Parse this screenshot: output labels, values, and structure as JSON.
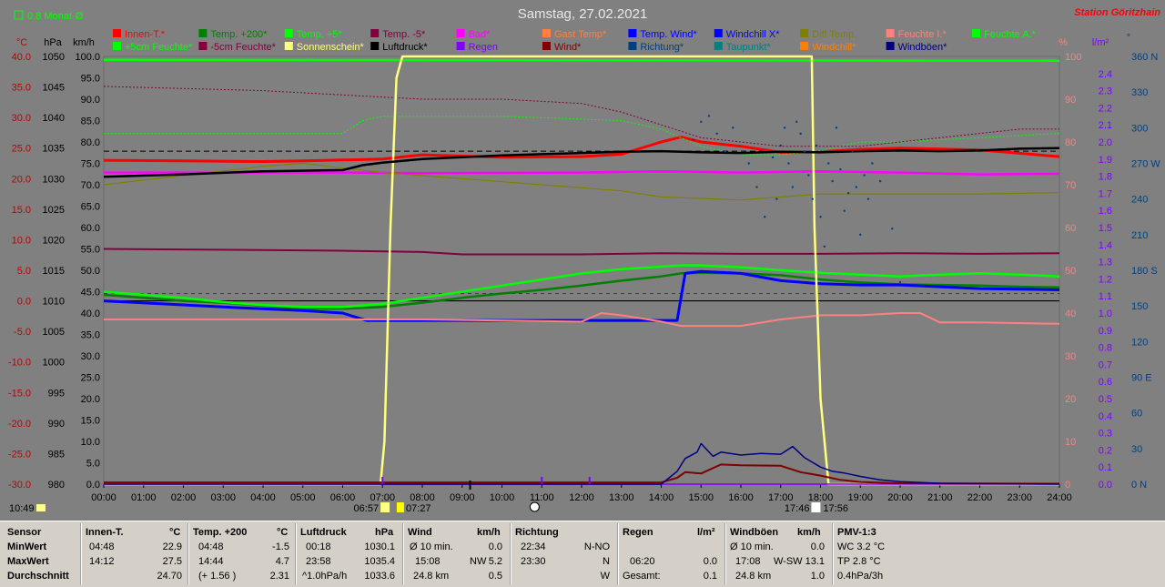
{
  "header": {
    "title": "Samstag, 27.02.2021",
    "station": "Station Göritzhain",
    "monthly_avg": "0.8 Monat-Ø",
    "current_time": "10:49"
  },
  "legend": {
    "row1": [
      {
        "label": "Innen-T.*",
        "color": "#ff0000"
      },
      {
        "label": "Temp. +200*",
        "color": "#008000"
      },
      {
        "label": "Temp. +5*",
        "color": "#00ff00"
      },
      {
        "label": "Temp. -5*",
        "color": "#800040"
      },
      {
        "label": "Bad*",
        "color": "#ff00ff"
      },
      {
        "label": "Gast Temp*",
        "color": "#ff8040"
      },
      {
        "label": "Temp. Wind*",
        "color": "#0000ff"
      },
      {
        "label": "Windchill X*",
        "color": "#0000ff"
      },
      {
        "label": "Diff Temp.",
        "color": "#808000"
      },
      {
        "label": "Feuchte I.*",
        "color": "#ff8080"
      },
      {
        "label": "Feuchte A.*",
        "color": "#00ff00"
      }
    ],
    "row2": [
      {
        "label": "+5cm Feuchte*",
        "color": "#00ff00"
      },
      {
        "label": "-5cm Feuchte*",
        "color": "#800040"
      },
      {
        "label": "Sonnenschein*",
        "color": "#ffff80"
      },
      {
        "label": "Luftdruck*",
        "color": "#000000"
      },
      {
        "label": "Regen",
        "color": "#8000ff"
      },
      {
        "label": "Wind*",
        "color": "#800000"
      },
      {
        "label": "Richtung*",
        "color": "#004080"
      },
      {
        "label": "Taupunkt*",
        "color": "#008080"
      },
      {
        "label": "Windchill*",
        "color": "#ff8000"
      },
      {
        "label": "Windböen*",
        "color": "#000080"
      }
    ]
  },
  "axes": {
    "left_units": {
      "temp": "°C",
      "hpa": "hPa",
      "kmh": "km/h"
    },
    "right_units": {
      "pct": "%",
      "lm2": "l/m²",
      "deg": "°"
    },
    "temp_ticks": [
      "40.0",
      "35.0",
      "30.0",
      "25.0",
      "20.0",
      "15.0",
      "10.0",
      "5.0",
      "0.0",
      "-5.0",
      "-10.0",
      "-15.0",
      "-20.0",
      "-25.0",
      "-30.0"
    ],
    "hpa_ticks": [
      "1050",
      "1045",
      "1040",
      "1035",
      "1030",
      "1025",
      "1020",
      "1015",
      "1010",
      "1005",
      "1000",
      "995",
      "990",
      "985",
      "980"
    ],
    "kmh_ticks": [
      "100.0",
      "95.0",
      "90.0",
      "85.0",
      "80.0",
      "75.0",
      "70.0",
      "65.0",
      "60.0",
      "55.0",
      "50.0",
      "45.0",
      "40.0",
      "35.0",
      "30.0",
      "25.0",
      "20.0",
      "15.0",
      "10.0",
      "5.0",
      "0.0"
    ],
    "pct_ticks": [
      "100",
      "90",
      "80",
      "70",
      "60",
      "50",
      "40",
      "30",
      "20",
      "10",
      "0"
    ],
    "lm2_ticks": [
      "2.4",
      "2.3",
      "2.2",
      "2.1",
      "2.0",
      "1.9",
      "1.8",
      "1.7",
      "1.6",
      "1.5",
      "1.4",
      "1.3",
      "1.2",
      "1.1",
      "1.0",
      "0.9",
      "0.8",
      "0.7",
      "0.6",
      "0.5",
      "0.4",
      "0.3",
      "0.2",
      "0.1",
      "0.0"
    ],
    "deg_ticks": [
      {
        "v": 360,
        "l": "360 N"
      },
      {
        "v": 330,
        "l": "330"
      },
      {
        "v": 300,
        "l": "300"
      },
      {
        "v": 270,
        "l": "270 W"
      },
      {
        "v": 240,
        "l": "240"
      },
      {
        "v": 210,
        "l": "210"
      },
      {
        "v": 180,
        "l": "180 S"
      },
      {
        "v": 150,
        "l": "150"
      },
      {
        "v": 120,
        "l": "120"
      },
      {
        "v": 90,
        "l": "90 E"
      },
      {
        "v": 60,
        "l": "60"
      },
      {
        "v": 30,
        "l": "30"
      },
      {
        "v": 0,
        "l": "0 N"
      }
    ],
    "x_ticks": [
      "00:00",
      "01:00",
      "02:00",
      "03:00",
      "04:00",
      "05:00",
      "06:00",
      "07:00",
      "08:00",
      "09:00",
      "10:00",
      "11:00",
      "12:00",
      "13:00",
      "14:00",
      "15:00",
      "16:00",
      "17:00",
      "18:00",
      "19:00",
      "20:00",
      "21:00",
      "22:00",
      "23:00",
      "24:00"
    ]
  },
  "sun_events": {
    "dawn": "06:57",
    "sunrise": "07:27",
    "sunset": "17:46",
    "dusk": "17:56"
  },
  "chart_data": {
    "type": "line",
    "title": "Samstag, 27.02.2021",
    "x_unit": "hours",
    "xlim": [
      0,
      24
    ],
    "ylim_temp": [
      -30,
      40
    ],
    "ylim_kmh": [
      0,
      100
    ],
    "ylim_pct": [
      0,
      100
    ],
    "series": [
      {
        "name": "Innen-T.*",
        "axis": "temp",
        "color": "#ff0000",
        "x": [
          0,
          2,
          4,
          5,
          7,
          8,
          10,
          12,
          13,
          14,
          14.5,
          15,
          16,
          17,
          18,
          19,
          20,
          22,
          24
        ],
        "y": [
          23.0,
          22.9,
          22.8,
          22.9,
          23.2,
          23.9,
          23.5,
          23.6,
          24.0,
          26.0,
          26.8,
          26.0,
          25.3,
          24.3,
          24.4,
          24.8,
          25.0,
          24.7,
          23.6
        ]
      },
      {
        "name": "Temp. +200*",
        "axis": "temp",
        "color": "#008000",
        "x": [
          0,
          1,
          2,
          3,
          4,
          5,
          6,
          7,
          8,
          9,
          10,
          11,
          12,
          13,
          14,
          14.5,
          15,
          16,
          17,
          18,
          19,
          20,
          21,
          22,
          23,
          24
        ],
        "y": [
          1.0,
          0.5,
          0.0,
          -0.3,
          -0.8,
          -1.3,
          -1.3,
          -1.0,
          -0.3,
          0.5,
          1.2,
          1.8,
          2.5,
          3.3,
          4.0,
          4.5,
          4.6,
          4.5,
          4.2,
          3.5,
          3.0,
          2.7,
          2.6,
          2.5,
          2.3,
          2.2
        ]
      },
      {
        "name": "Temp. +5*",
        "axis": "temp",
        "color": "#00ff00",
        "x": [
          0,
          1,
          2,
          3,
          4,
          5,
          6,
          7,
          8,
          9,
          10,
          11,
          12,
          13,
          14,
          14.5,
          15,
          16,
          17,
          18,
          19,
          20,
          21,
          22,
          23,
          24
        ],
        "y": [
          1.5,
          1.0,
          0.5,
          -0.2,
          -0.7,
          -1.0,
          -1.0,
          -0.5,
          0.5,
          1.5,
          2.5,
          3.5,
          4.5,
          5.2,
          5.6,
          5.8,
          5.8,
          5.5,
          5.0,
          4.6,
          4.3,
          4.0,
          4.3,
          4.5,
          4.3,
          4.0
        ]
      },
      {
        "name": "Temp. -5*",
        "axis": "temp",
        "color": "#800040",
        "x": [
          0,
          4,
          6,
          8,
          9,
          12,
          14,
          16,
          18,
          20,
          22,
          24
        ],
        "y": [
          8.5,
          8.3,
          8.2,
          8.0,
          7.6,
          7.6,
          7.8,
          7.7,
          7.7,
          7.8,
          7.7,
          7.8
        ]
      },
      {
        "name": "Bad*",
        "axis": "temp",
        "color": "#ff00ff",
        "x": [
          0,
          6,
          8,
          12,
          14,
          16,
          18,
          20,
          22,
          24
        ],
        "y": [
          21.0,
          21.0,
          20.9,
          21.0,
          21.2,
          21.0,
          21.2,
          21.0,
          20.7,
          20.8
        ]
      },
      {
        "name": "Temp. Wind*",
        "axis": "temp",
        "color": "#0000ff",
        "x": [
          0,
          3,
          5,
          6,
          6.4,
          6.6,
          9,
          12,
          14,
          14.4,
          14.6,
          15,
          16,
          17,
          18,
          19,
          20,
          21,
          22,
          24
        ],
        "y": [
          0.0,
          -1.0,
          -1.6,
          -2.0,
          -2.8,
          -3.2,
          -3.2,
          -3.2,
          -3.2,
          -3.2,
          4.5,
          4.8,
          4.5,
          3.3,
          2.8,
          2.6,
          2.6,
          2.3,
          2.0,
          1.8
        ]
      },
      {
        "name": "Diff Temp.",
        "axis": "temp",
        "color": "#808000",
        "x": [
          0,
          2,
          4,
          5,
          7,
          9,
          11,
          13,
          14,
          16,
          18,
          20,
          22,
          24
        ],
        "y": [
          19.0,
          20.5,
          22.0,
          22.5,
          21.0,
          20.0,
          19.0,
          18.0,
          17.0,
          16.5,
          17.5,
          17.5,
          17.5,
          17.7
        ]
      },
      {
        "name": "Feuchte I.*",
        "axis": "pct",
        "color": "#ff8080",
        "x": [
          0,
          4,
          8,
          12,
          12.5,
          13,
          14,
          14.5,
          15,
          16,
          17,
          18,
          19,
          20,
          20.5,
          21,
          22,
          24
        ],
        "y": [
          38.5,
          38.5,
          38.5,
          38.0,
          40,
          39.5,
          38,
          37,
          37,
          37,
          38.5,
          39.5,
          39.5,
          40,
          40,
          37.8,
          37.8,
          37.5
        ]
      },
      {
        "name": "Feuchte A.*",
        "axis": "pct",
        "color": "#00ff00",
        "x": [
          0,
          24
        ],
        "y": [
          99.2,
          99.0
        ]
      },
      {
        "name": "+5cm Feuchte*",
        "axis": "pct",
        "color": "#00ff00",
        "x": [
          0,
          6,
          6.5,
          7,
          10,
          13,
          14,
          15,
          16,
          17,
          18,
          19,
          20,
          22,
          24
        ],
        "y": [
          82,
          82,
          85,
          86,
          86,
          85,
          83,
          79,
          77,
          77,
          78,
          80,
          80,
          81,
          82
        ]
      },
      {
        "name": "-5cm Feuchte*",
        "axis": "pct",
        "color": "#800040",
        "x": [
          0,
          4,
          6,
          8,
          10,
          12,
          13,
          14,
          15,
          16,
          17,
          18,
          19,
          20,
          21,
          22,
          23,
          24
        ],
        "y": [
          93,
          92,
          91,
          90,
          90,
          89,
          87,
          84,
          81,
          80,
          79,
          79,
          79,
          80,
          81,
          82,
          83,
          83
        ]
      },
      {
        "name": "Sonnenschein*",
        "axis": "pct",
        "color": "#ffff80",
        "x": [
          0,
          6.95,
          7.05,
          7.2,
          7.35,
          7.5,
          8,
          17.7,
          17.78,
          17.85,
          18.0,
          18.2,
          24
        ],
        "y": [
          0,
          0,
          10,
          60,
          95,
          100,
          100,
          100,
          100,
          60,
          20,
          0,
          0
        ]
      },
      {
        "name": "Luftdruck*",
        "axis": "hpa",
        "color": "#000000",
        "x": [
          0,
          2,
          4,
          6,
          6.5,
          7,
          8,
          9,
          10,
          11,
          12,
          13,
          14,
          15,
          16,
          17,
          18,
          19,
          20,
          21,
          22,
          23,
          24
        ],
        "y": [
          1030.3,
          1030.7,
          1031.2,
          1031.4,
          1032.2,
          1032.6,
          1033.2,
          1033.5,
          1033.8,
          1034.0,
          1034.2,
          1034.4,
          1034.5,
          1034.3,
          1034.2,
          1034.4,
          1034.3,
          1034.5,
          1034.6,
          1034.5,
          1034.6,
          1034.9,
          1035.0
        ]
      },
      {
        "name": "Regen",
        "axis": "lm2",
        "color": "#8000ff",
        "x": [
          0,
          24
        ],
        "y": [
          0.0,
          0.0
        ]
      },
      {
        "name": "Wind*",
        "axis": "kmh",
        "color": "#800000",
        "x": [
          0,
          14,
          14.4,
          14.6,
          15,
          15.5,
          16,
          17,
          17.5,
          18,
          18.5,
          19,
          20,
          24
        ],
        "y": [
          0.4,
          0.4,
          1.5,
          2.8,
          2.5,
          4.6,
          4.4,
          4.3,
          2.8,
          2.0,
          1.0,
          0.5,
          0.2,
          0.1
        ]
      },
      {
        "name": "Windböen*",
        "axis": "kmh",
        "color": "#000080",
        "x": [
          0,
          14,
          14.4,
          14.6,
          14.9,
          15,
          15.3,
          15.5,
          16,
          16.5,
          17,
          17.3,
          17.6,
          18,
          18.3,
          18.6,
          19,
          19.5,
          20,
          21,
          24
        ],
        "y": [
          0,
          0,
          3,
          6,
          7.5,
          9.5,
          6.5,
          7.5,
          6.8,
          7.2,
          7.0,
          8.8,
          6.2,
          4.0,
          3.0,
          2.6,
          1.8,
          1.0,
          0.6,
          0.2,
          0
        ]
      }
    ],
    "scatter": [
      {
        "name": "Richtung*",
        "axis": "deg",
        "color": "#004080",
        "x": [
          14.8,
          15.0,
          15.2,
          15.4,
          15.6,
          15.8,
          16.2,
          16.4,
          16.6,
          16.8,
          16.9,
          17.0,
          17.1,
          17.2,
          17.3,
          17.4,
          17.5,
          17.6,
          17.7,
          17.8,
          17.9,
          18.0,
          18.1,
          18.2,
          18.3,
          18.4,
          18.5,
          18.6,
          18.7,
          18.8,
          18.9,
          19.0,
          19.1,
          19.2,
          19.3,
          19.5,
          19.8,
          20.0
        ],
        "y": [
          290,
          305,
          310,
          295,
          280,
          300,
          270,
          250,
          225,
          275,
          240,
          285,
          300,
          270,
          250,
          305,
          295,
          280,
          260,
          240,
          285,
          225,
          200,
          270,
          255,
          300,
          265,
          230,
          245,
          280,
          250,
          210,
          260,
          240,
          270,
          255,
          215,
          170
        ]
      }
    ]
  },
  "summary": {
    "sensor": {
      "title": "Sensor",
      "rows": [
        "MinWert",
        "MaxWert",
        "Durchschnitt"
      ]
    },
    "innen": {
      "title": "Innen-T.",
      "unit": "°C",
      "rows": [
        {
          "t": "04:48",
          "v": "22.9"
        },
        {
          "t": "14:12",
          "v": "27.5"
        },
        {
          "t": "",
          "v": "24.70"
        }
      ]
    },
    "temp200": {
      "title": "Temp. +200",
      "unit": "°C",
      "rows": [
        {
          "t": "04:48",
          "v": "-1.5"
        },
        {
          "t": "14:44",
          "v": "4.7"
        },
        {
          "t": "(+ 1.56 )",
          "v": "2.31"
        }
      ]
    },
    "luftdruck": {
      "title": "Luftdruck",
      "unit": "hPa",
      "rows": [
        {
          "t": "00:18",
          "v": "1030.1"
        },
        {
          "t": "23:58",
          "v": "1035.4"
        },
        {
          "t": "^1.0hPa/h",
          "v": "1033.6"
        }
      ]
    },
    "wind": {
      "title": "Wind",
      "unit": "km/h",
      "rows": [
        {
          "t": "Ø 10 min.",
          "m": "",
          "v": "0.0"
        },
        {
          "t": "15:08",
          "m": "NW",
          "v": "5.2"
        },
        {
          "t": "24.8 km",
          "m": "",
          "v": "0.5"
        }
      ]
    },
    "richtung": {
      "title": "Richtung",
      "rows": [
        {
          "t": "22:34",
          "v": "N-NO"
        },
        {
          "t": "23:30",
          "v": "N"
        },
        {
          "t": "",
          "v": "W"
        }
      ]
    },
    "regen": {
      "title": "Regen",
      "unit": "l/m²",
      "rows": [
        {
          "t": "",
          "v": ""
        },
        {
          "t": "06:20",
          "v": "0.0"
        },
        {
          "t": "Gesamt:",
          "v": "0.1"
        }
      ]
    },
    "windboeen": {
      "title": "Windböen",
      "unit": "km/h",
      "rows": [
        {
          "t": "Ø 10 min.",
          "m": "",
          "v": "0.0"
        },
        {
          "t": "17:08",
          "m": "W-SW",
          "v": "13.1"
        },
        {
          "t": "24.8 km",
          "m": "",
          "v": "1.0"
        }
      ]
    },
    "pmv": {
      "title": "PMV-1:3",
      "rows": [
        "WC 3.2 °C",
        "TP 2.8 °C",
        "0.4hPa/3h"
      ]
    }
  }
}
